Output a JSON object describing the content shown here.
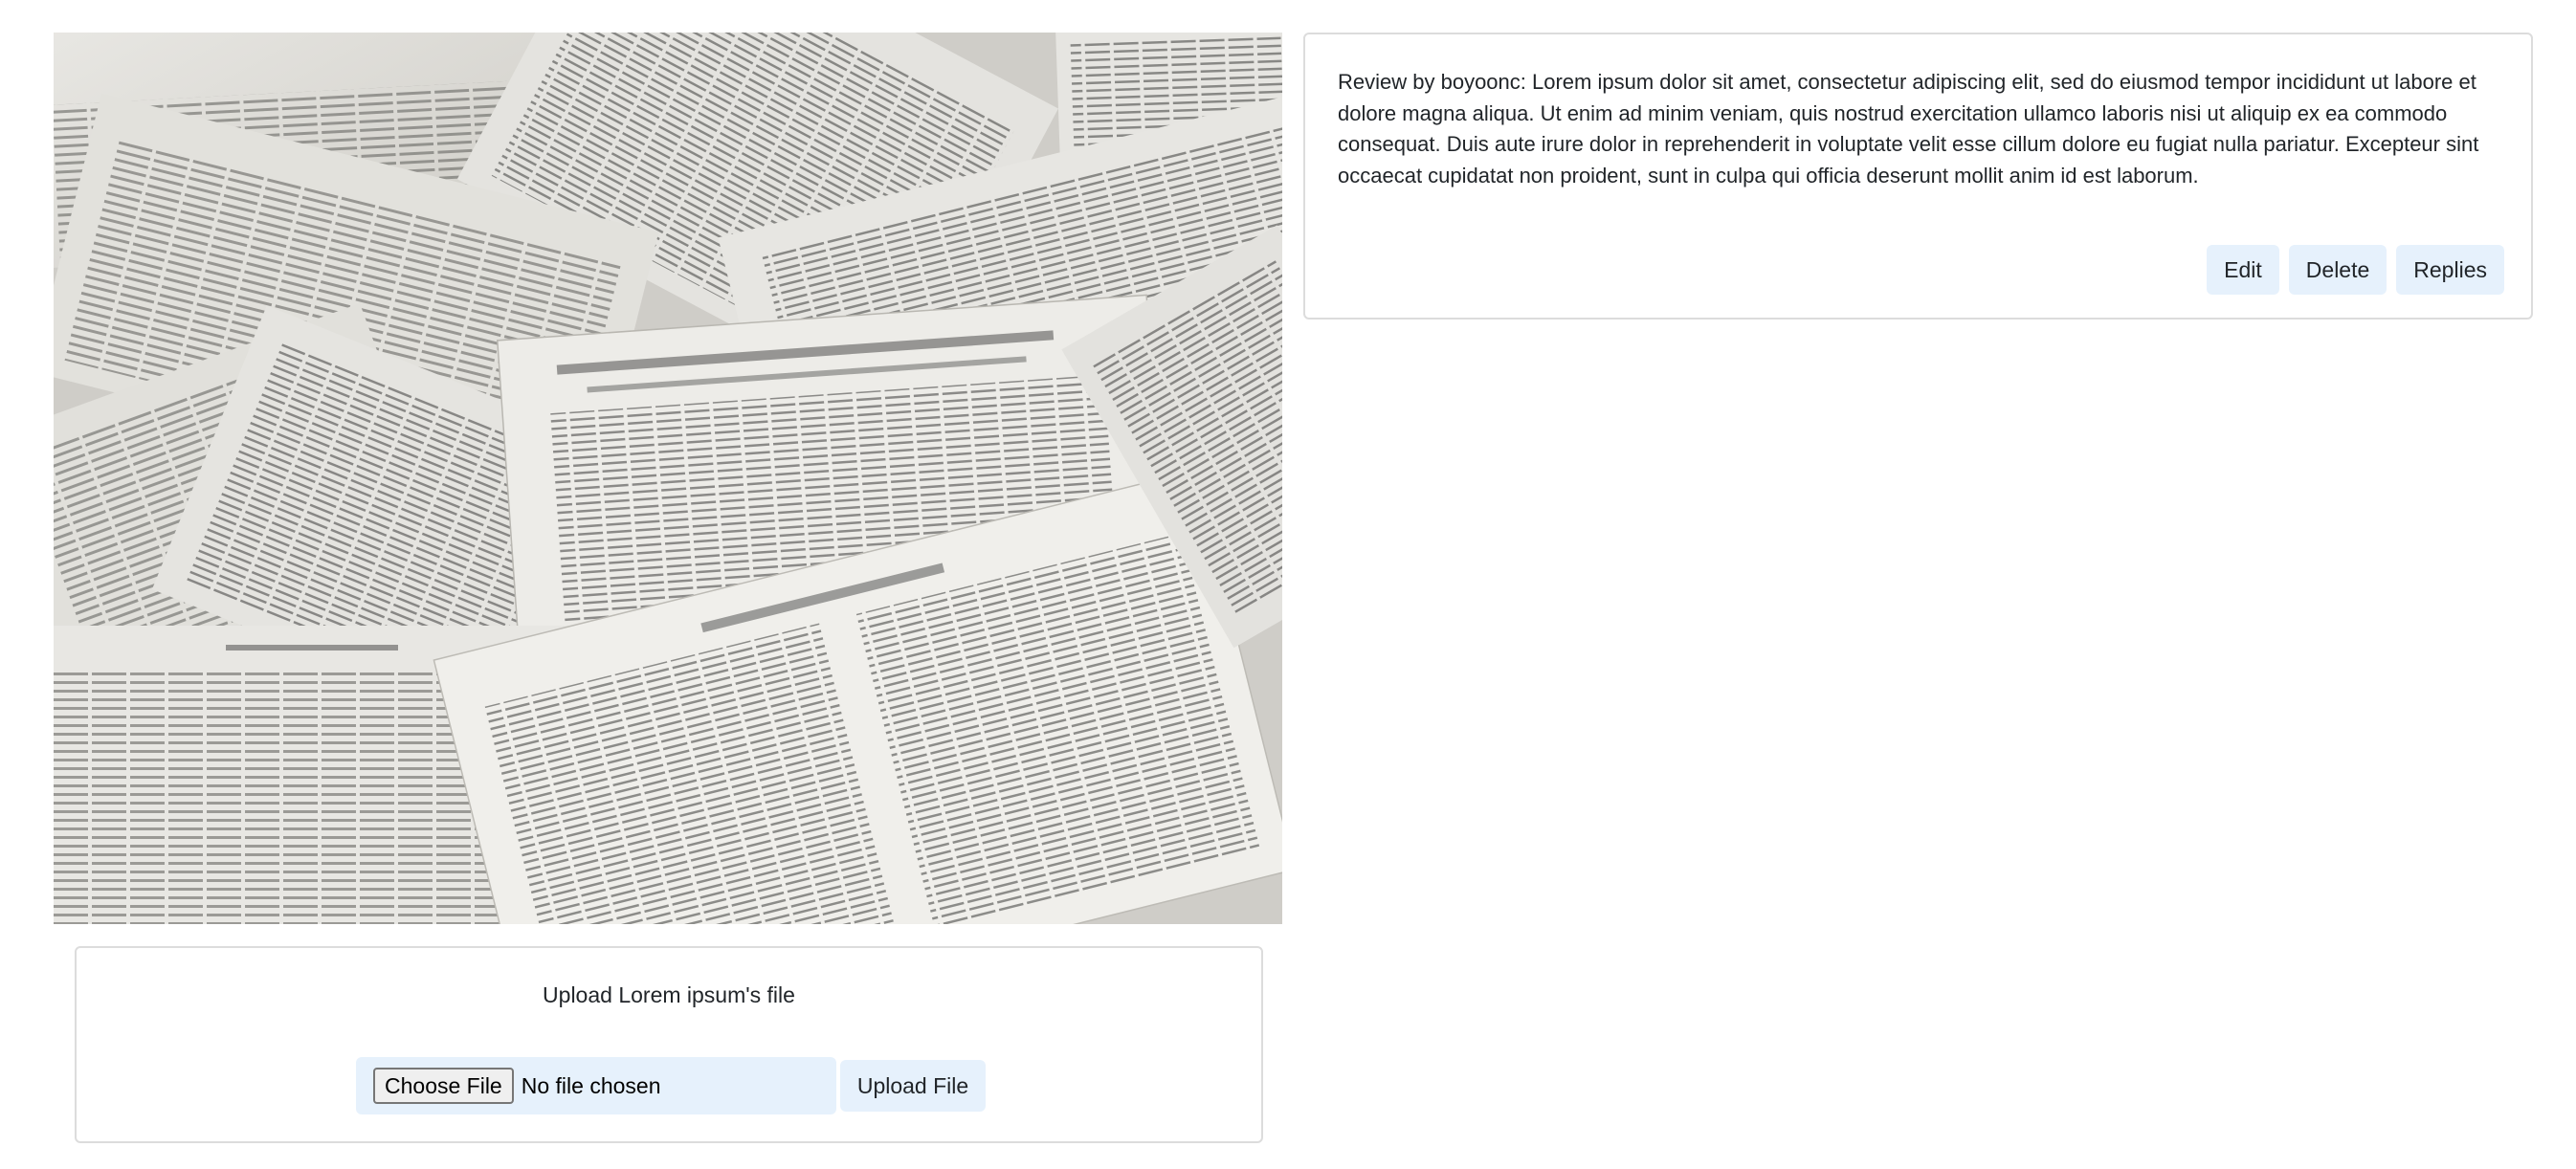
{
  "image": {
    "alt": "Scattered vintage book pages"
  },
  "review": {
    "text": "Review by boyoonc: Lorem ipsum dolor sit amet, consectetur adipiscing elit, sed do eiusmod tempor incididunt ut labore et dolore magna aliqua. Ut enim ad minim veniam, quis nostrud exercitation ullamco laboris nisi ut aliquip ex ea commodo consequat. Duis aute irure dolor in reprehenderit in voluptate velit esse cillum dolore eu fugiat nulla pariatur. Excepteur sint occaecat cupidatat non proident, sunt in culpa qui officia deserunt mollit anim id est laborum.",
    "edit_label": "Edit",
    "delete_label": "Delete",
    "replies_label": "Replies"
  },
  "upload": {
    "title": "Upload Lorem ipsum's file",
    "choose_label": "Choose File",
    "file_status": "No file chosen",
    "submit_label": "Upload File"
  },
  "colors": {
    "button_bg": "#e6f1fc",
    "card_border": "#dcdcdc",
    "text": "#212529"
  }
}
